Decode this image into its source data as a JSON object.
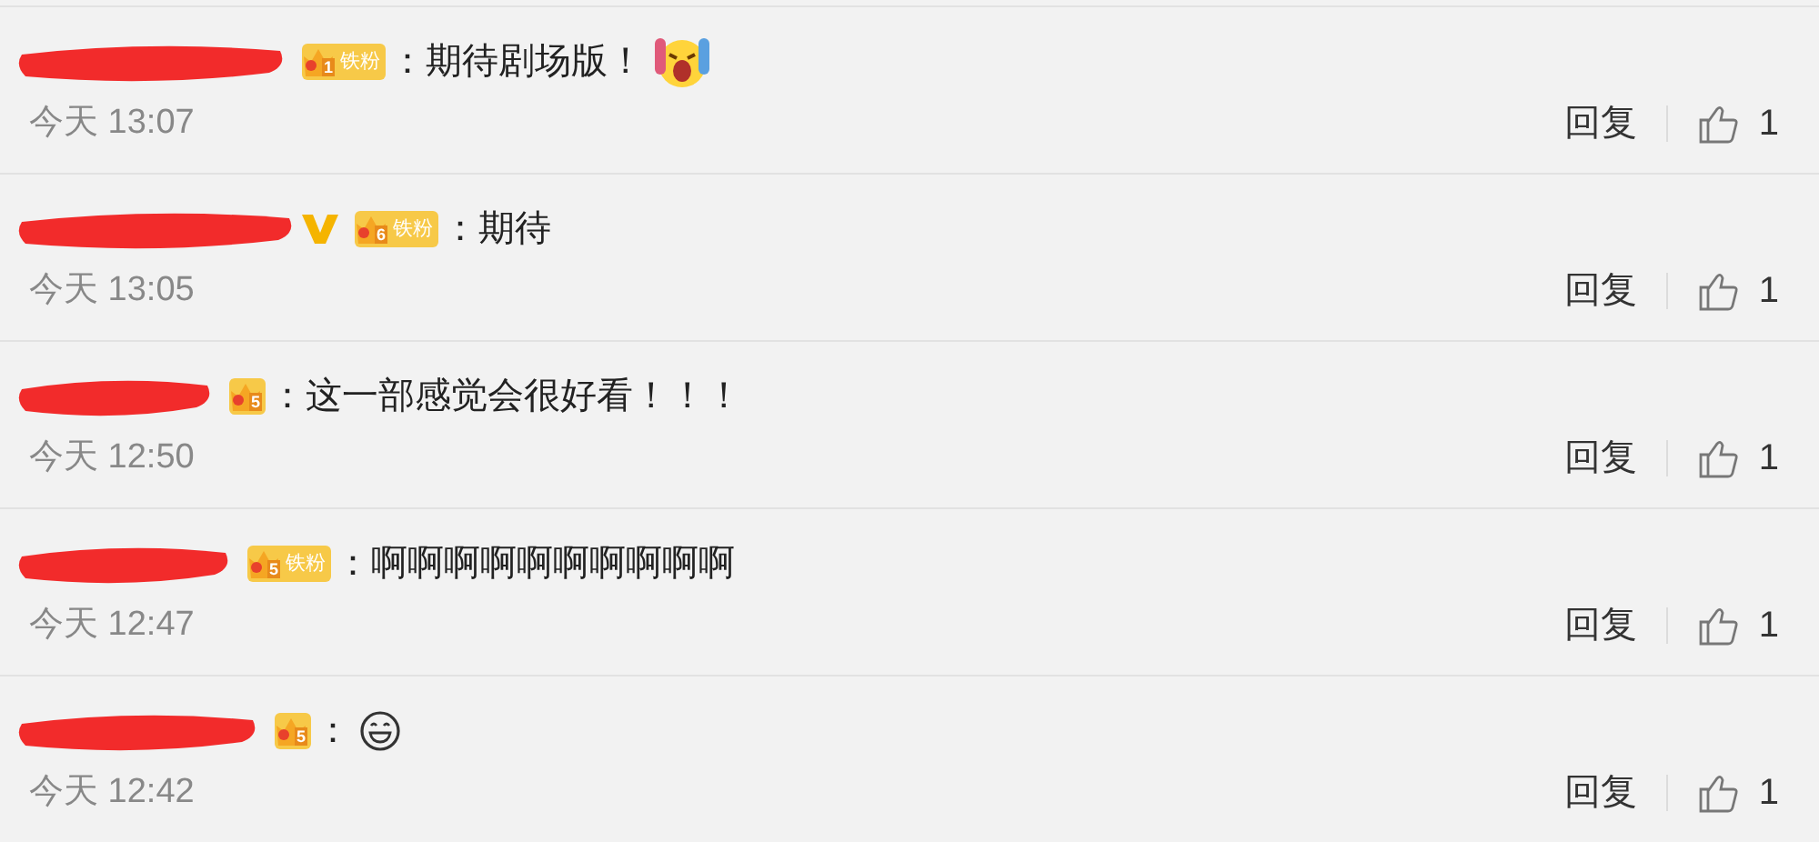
{
  "comments": [
    {
      "verified": false,
      "badge": {
        "level": "1",
        "fan_label": "铁粉"
      },
      "separator": "：",
      "content": "期待剧场版！",
      "emoji": {
        "kind": "scream"
      },
      "time": "今天 13:07",
      "reply": "回复",
      "likes": "1"
    },
    {
      "verified": true,
      "badge": {
        "level": "6",
        "fan_label": "铁粉"
      },
      "separator": "：",
      "content": "期待",
      "time": "今天 13:05",
      "reply": "回复",
      "likes": "1"
    },
    {
      "verified": false,
      "badge": {
        "level": "5"
      },
      "separator": "：",
      "content": "这一部感觉会很好看！！！",
      "time": "今天 12:50",
      "reply": "回复",
      "likes": "1"
    },
    {
      "verified": false,
      "badge": {
        "level": "5",
        "fan_label": "铁粉"
      },
      "separator": "：",
      "content": "啊啊啊啊啊啊啊啊啊啊",
      "time": "今天 12:47",
      "reply": "回复",
      "likes": "1"
    },
    {
      "verified": false,
      "badge": {
        "level": "5"
      },
      "separator": "：",
      "emoji": {
        "kind": "grin"
      },
      "time": "今天 12:42",
      "reply": "回复",
      "likes": "1"
    }
  ]
}
